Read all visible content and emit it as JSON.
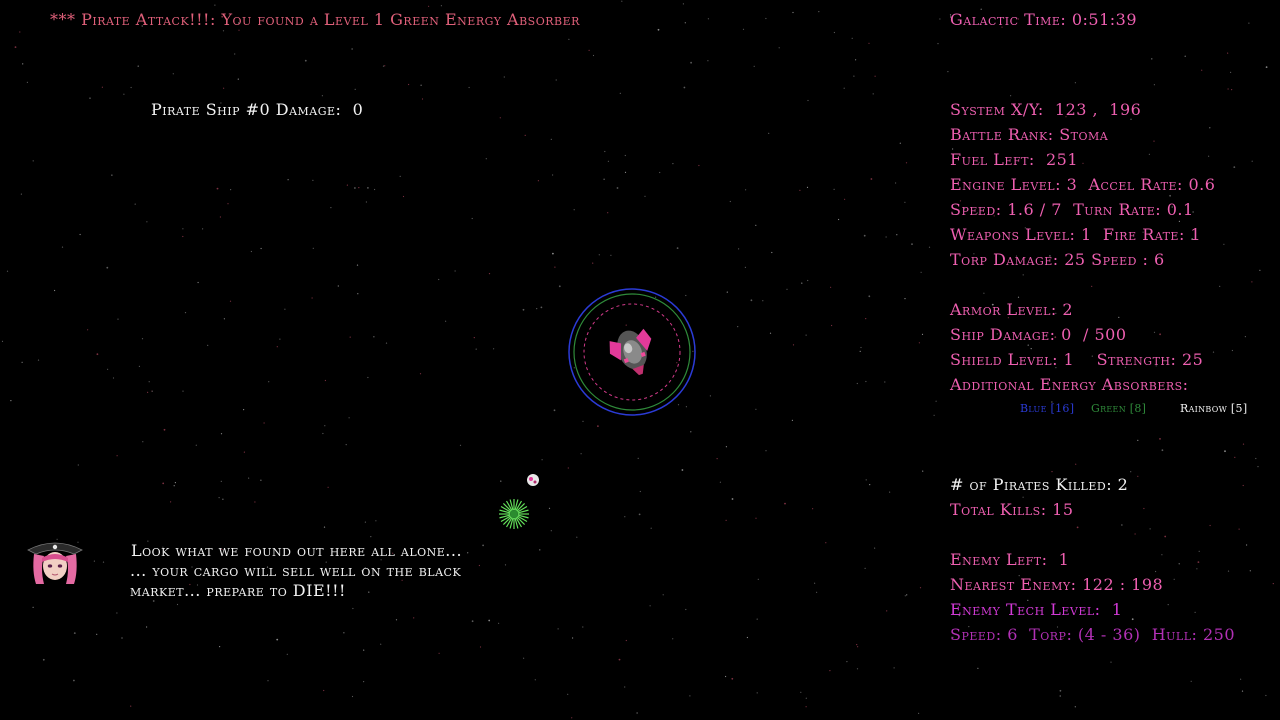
{
  "alert": "*** Pirate Attack!!!: You found a Level 1 Green Energy Absorber",
  "galactic_time": "Galactic Time: 0:51:39",
  "pirate_ship_damage": "Pirate Ship #0 Damage:  0",
  "stats": {
    "system_xy": "System X/Y:  123 ,  196",
    "battle_rank": "Battle Rank: Stoma",
    "fuel_left": "Fuel Left:  251",
    "engine": "Engine Level: 3  Accel Rate: 0.6",
    "speed": "Speed: 1.6 / 7  Turn Rate: 0.1",
    "weapons": "Weapons Level: 1  Fire Rate: 1",
    "torp": "Torp Damage: 25 Speed : 6",
    "armor": "Armor Level: 2",
    "ship_damage": "Ship Damage: 0  / 500",
    "shield": "Shield Level: 1    Strength: 25",
    "absorbers_title": "Additional Energy Absorbers:",
    "absorber_blue": "Blue [16]",
    "absorber_green": "Green [8]",
    "absorber_rainbow": "Rainbow [5]",
    "pirates_killed": "# of Pirates Killed: 2",
    "total_kills": "Total Kills: 15",
    "enemy_left": "Enemy Left:  1",
    "nearest_enemy": "Nearest Enemy: 122 : 198",
    "enemy_tech": "Enemy Tech Level:  1",
    "enemy_specs": "Speed: 6  Torp: (4 - 36)  Hull: 250"
  },
  "dialog": {
    "line1": "Look what we found out here all alone...",
    "line2": "... your cargo will sell well on the black",
    "line3": "market... prepare to DIE!!!"
  },
  "colors": {
    "background": "#000000",
    "stat_text": "#ee5fb0",
    "alert_text": "#e0607a",
    "white_text": "#f2f2f2",
    "enemy_text": "#d23ad6",
    "shield_blue": "#2b3bd6",
    "shield_green": "#2f8a3a"
  },
  "icons": {
    "player_ship": "player-ship-icon",
    "pirate_portrait": "pirate-captain-portrait",
    "enemy_ship": "enemy-ship-icon",
    "green_absorber": "green-energy-burst-icon"
  }
}
